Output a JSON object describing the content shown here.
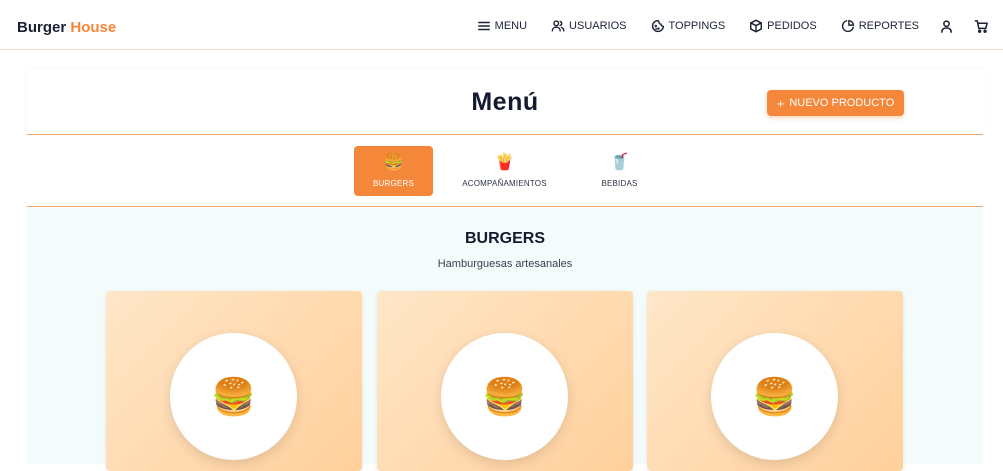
{
  "brand": {
    "name": "Burger",
    "accent": "House"
  },
  "nav": {
    "items": [
      {
        "label": "MENU",
        "icon": "menu-icon"
      },
      {
        "label": "USUARIOS",
        "icon": "users-icon"
      },
      {
        "label": "TOPPINGS",
        "icon": "cookie-icon"
      },
      {
        "label": "PEDIDOS",
        "icon": "package-icon"
      },
      {
        "label": "REPORTES",
        "icon": "pie-chart-icon"
      }
    ],
    "user_icon": "user-icon",
    "cart_icon": "cart-icon"
  },
  "header": {
    "title": "Menú",
    "new_button_label": "NUEVO PRODUCTO",
    "new_button_plus": "+"
  },
  "categories": [
    {
      "label": "BURGERS",
      "emoji": "🍔",
      "active": true
    },
    {
      "label": "ACOMPAÑAMIENTOS",
      "emoji": "🍟",
      "active": false
    },
    {
      "label": "BEBIDAS",
      "emoji": "🥤",
      "active": false
    }
  ],
  "section": {
    "title": "BURGERS",
    "subtitle": "Hamburguesas artesanales"
  },
  "products": [
    {
      "emoji": "🍔"
    },
    {
      "emoji": "🍔"
    },
    {
      "emoji": "🍔"
    }
  ],
  "colors": {
    "accent": "#f5873b",
    "text_dark": "#141a2e",
    "section_bg": "#f4fbfb"
  }
}
